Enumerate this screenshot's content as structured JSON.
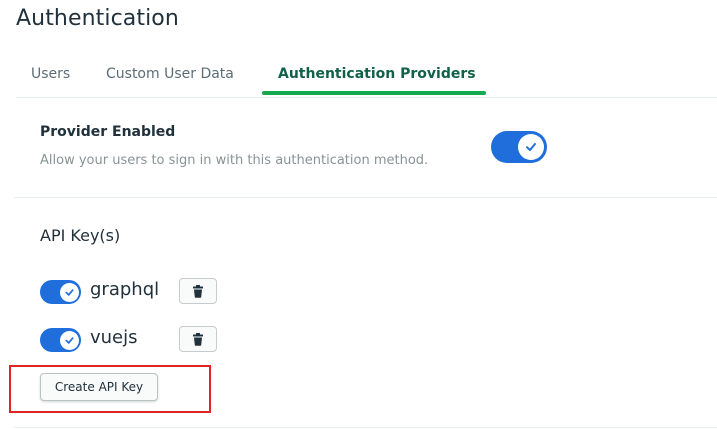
{
  "page": {
    "title": "Authentication"
  },
  "tabs": [
    {
      "label": "Users",
      "active": false
    },
    {
      "label": "Custom User Data",
      "active": false
    },
    {
      "label": "Authentication Providers",
      "active": true
    }
  ],
  "provider": {
    "title": "Provider Enabled",
    "description": "Allow your users to sign in with this authentication method.",
    "enabled": true
  },
  "api_keys": {
    "title": "API Key(s)",
    "items": [
      {
        "name": "graphql",
        "enabled": true,
        "delete_icon": "trash-icon"
      },
      {
        "name": "vuejs",
        "enabled": true,
        "delete_icon": "trash-icon"
      }
    ],
    "create_label": "Create API Key"
  },
  "colors": {
    "toggle_on": "#1f6edc",
    "active_tab": "#116149",
    "tab_underline": "#13aa52",
    "highlight": "#e02424"
  },
  "icons": {
    "check": "check-icon",
    "trash": "trash-icon"
  }
}
